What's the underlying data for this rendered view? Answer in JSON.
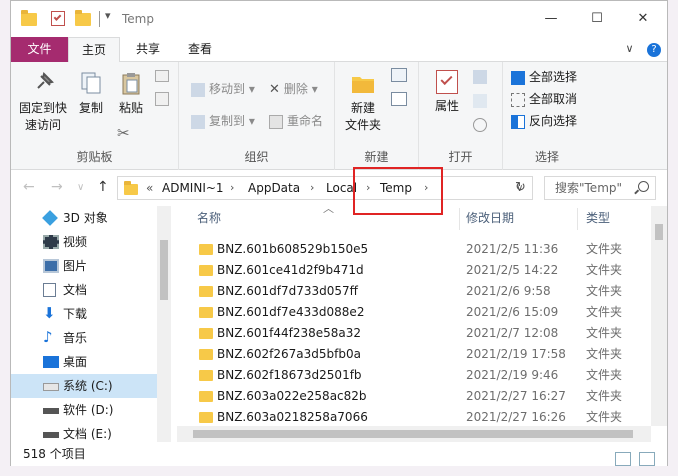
{
  "window": {
    "title": "Temp",
    "controls": {
      "minimize": "—",
      "maximize": "☐",
      "close": "✕"
    }
  },
  "ribbon_tabs": {
    "file": "文件",
    "home": "主页",
    "share": "共享",
    "view": "查看",
    "expand": "∨",
    "help": "?"
  },
  "ribbon": {
    "clipboard": {
      "label": "剪贴板",
      "pin_l1": "固定到快",
      "pin_l2": "速访问",
      "copy": "复制",
      "paste": "粘贴"
    },
    "organize": {
      "label": "组织",
      "move_to": "移动到",
      "copy_to": "复制到",
      "delete": "删除",
      "rename": "重命名"
    },
    "new": {
      "label": "新建",
      "new_l1": "新建",
      "new_l2": "文件夹"
    },
    "open": {
      "label": "打开",
      "properties": "属性"
    },
    "select": {
      "label": "选择",
      "select_all": "全部选择",
      "select_none": "全部取消",
      "invert": "反向选择"
    }
  },
  "address": {
    "back": "←",
    "forward": "→",
    "recent": "∨",
    "up": "↑",
    "overflow": "«",
    "crumbs": [
      "ADMINI~1",
      "AppData",
      "Local",
      "Temp"
    ],
    "sep": "›",
    "dropdown": "∨",
    "refresh": "↻",
    "search_placeholder": "搜索\"Temp\""
  },
  "nav_pane": {
    "items": [
      {
        "label": "3D 对象",
        "icon": "3d-objects-icon",
        "color": "#3aa0e0"
      },
      {
        "label": "视频",
        "icon": "video-icon",
        "color": "#2f3b4a"
      },
      {
        "label": "图片",
        "icon": "pictures-icon",
        "color": "#3c6ea8"
      },
      {
        "label": "文档",
        "icon": "documents-icon",
        "color": "#6b7d94"
      },
      {
        "label": "下载",
        "icon": "downloads-icon",
        "color": "#1a73d9"
      },
      {
        "label": "音乐",
        "icon": "music-icon",
        "color": "#1a73d9"
      },
      {
        "label": "桌面",
        "icon": "desktop-icon",
        "color": "#1a73d9"
      },
      {
        "label": "系统 (C:)",
        "icon": "drive-c-icon",
        "color": "#777777"
      },
      {
        "label": "软件 (D:)",
        "icon": "drive-d-icon",
        "color": "#555555"
      },
      {
        "label": "文档 (E:)",
        "icon": "drive-e-icon",
        "color": "#555555"
      }
    ],
    "selected_index": 7
  },
  "file_list": {
    "columns": {
      "name": "名称",
      "modified": "修改日期",
      "type": "类型"
    },
    "sort_indicator": "︿",
    "rows": [
      {
        "name": "BNZ.601b608529b150e5",
        "modified": "2021/2/5 11:36",
        "type": "文件夹"
      },
      {
        "name": "BNZ.601ce41d2f9b471d",
        "modified": "2021/2/5 14:22",
        "type": "文件夹"
      },
      {
        "name": "BNZ.601df7d733d057ff",
        "modified": "2021/2/6 9:58",
        "type": "文件夹"
      },
      {
        "name": "BNZ.601df7e433d088e2",
        "modified": "2021/2/6 15:09",
        "type": "文件夹"
      },
      {
        "name": "BNZ.601f44f238e58a32",
        "modified": "2021/2/7 12:08",
        "type": "文件夹"
      },
      {
        "name": "BNZ.602f267a3d5bfb0a",
        "modified": "2021/2/19 17:58",
        "type": "文件夹"
      },
      {
        "name": "BNZ.602f18673d2501fb",
        "modified": "2021/2/19 9:46",
        "type": "文件夹"
      },
      {
        "name": "BNZ.603a022e258ac82b",
        "modified": "2021/2/27 16:27",
        "type": "文件夹"
      },
      {
        "name": "BNZ.603a0218258a7066",
        "modified": "2021/2/27 16:26",
        "type": "文件夹"
      }
    ]
  },
  "status_bar": {
    "item_count": "518 个项目"
  },
  "colors": {
    "file_tab": "#a52b6f",
    "folder": "#f7c948",
    "selection": "#cce4f7",
    "highlight_box": "#e02424"
  }
}
